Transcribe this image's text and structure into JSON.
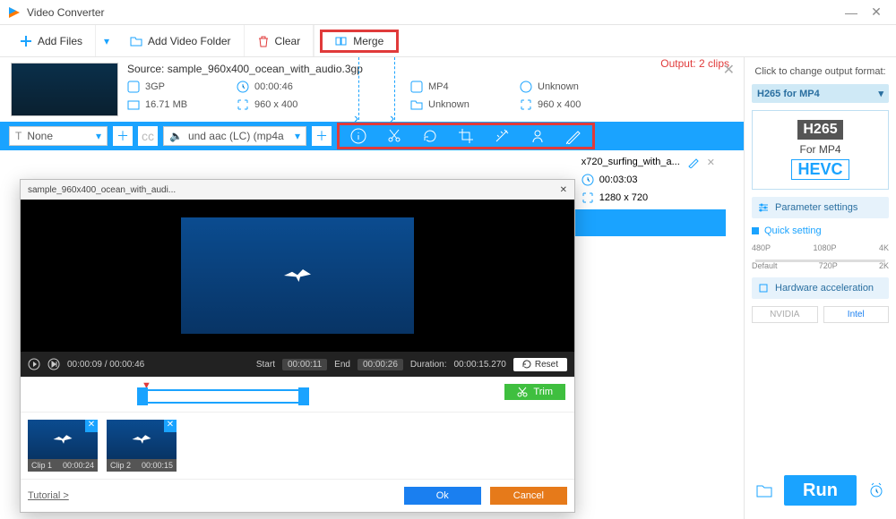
{
  "app_title": "Video Converter",
  "toolbar": {
    "add_files": "Add Files",
    "add_folder": "Add Video Folder",
    "clear": "Clear",
    "merge": "Merge"
  },
  "source": {
    "title_prefix": "Source: ",
    "filename": "sample_960x400_ocean_with_audio.3gp",
    "format": "3GP",
    "duration": "00:00:46",
    "size": "16.71 MB",
    "resolution": "960 x 400",
    "output_label": "Output: 2 clips",
    "out_format": "MP4",
    "out_dur": "Unknown",
    "out_folder": "Unknown",
    "out_res": "960 x 400",
    "subtitle_sel": "None",
    "audio_sel": "und aac (LC) (mp4a"
  },
  "item2": {
    "name_short": "x720_surfing_with_a...",
    "duration": "00:03:03",
    "resolution": "1280 x 720"
  },
  "right": {
    "click_change": "Click to change output format:",
    "profile": "H265 for MP4",
    "box_big": "H265",
    "box_mid": "For MP4",
    "box_hevc": "HEVC",
    "param": "Parameter settings",
    "quick": "Quick setting",
    "res_labels": [
      "480P",
      "1080P",
      "4K"
    ],
    "res_labels2": [
      "Default",
      "720P",
      "2K"
    ],
    "hwaccel": "Hardware acceleration",
    "nvidia": "NVIDIA",
    "intel": "Intel",
    "run": "Run"
  },
  "trim": {
    "title": "sample_960x400_ocean_with_audi...",
    "pos": "00:00:09 / 00:00:46",
    "start_lbl": "Start",
    "start": "00:00:11",
    "end_lbl": "End",
    "end": "00:00:26",
    "dur_lbl": "Duration:",
    "dur": "00:00:15.270",
    "reset": "Reset",
    "trim_btn": "Trim",
    "clips": [
      {
        "name": "Clip 1",
        "dur": "00:00:24"
      },
      {
        "name": "Clip 2",
        "dur": "00:00:15"
      }
    ],
    "tutorial": "Tutorial >",
    "ok": "Ok",
    "cancel": "Cancel"
  }
}
